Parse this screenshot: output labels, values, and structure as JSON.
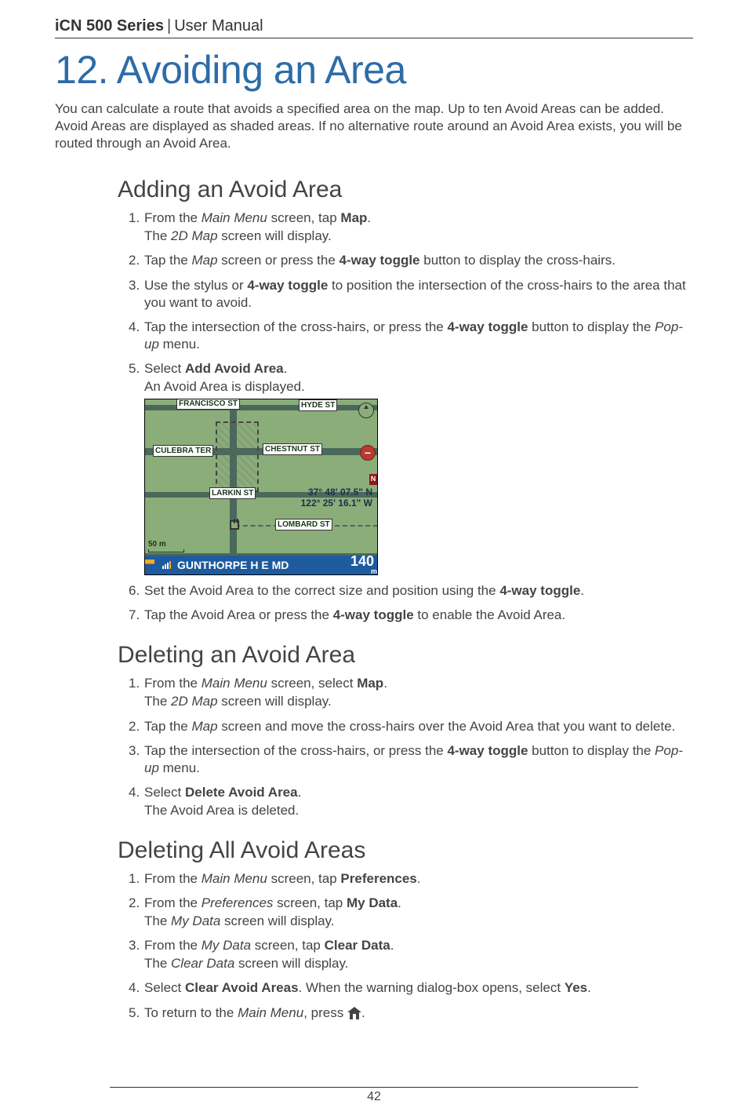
{
  "header": {
    "product": "iCN 500 Series",
    "separator": "|",
    "suffix": "User Manual"
  },
  "title": "12. Avoiding an Area",
  "intro": "You can calculate a route that avoids a specified area on the map. Up to ten Avoid Areas can be added. Avoid Areas are displayed as shaded areas. If no alternative route around an Avoid Area exists, you will be routed through an Avoid Area.",
  "sections": {
    "adding": {
      "heading": "Adding an Avoid Area",
      "steps": [
        {
          "num": "1.",
          "parts": [
            "From the ",
            {
              "i": "Main Menu"
            },
            " screen, tap ",
            {
              "b": "Map"
            },
            "."
          ],
          "sub": [
            "The ",
            {
              "i": "2D Map"
            },
            " screen will display."
          ]
        },
        {
          "num": "2.",
          "parts": [
            "Tap the ",
            {
              "i": "Map"
            },
            " screen or press the ",
            {
              "b": "4-way toggle"
            },
            " button to display the cross-hairs."
          ]
        },
        {
          "num": "3.",
          "parts": [
            "Use the stylus or ",
            {
              "b": "4-way toggle"
            },
            " to position the intersection of the cross-hairs to the area that you want to avoid."
          ]
        },
        {
          "num": "4.",
          "parts": [
            "Tap the intersection of the cross-hairs, or press the ",
            {
              "b": "4-way toggle"
            },
            " button to display the ",
            {
              "i": "Pop-up"
            },
            " menu."
          ]
        },
        {
          "num": "5.",
          "parts": [
            "Select ",
            {
              "b": "Add Avoid Area"
            },
            "."
          ],
          "sub": [
            "An Avoid Area is displayed."
          ]
        },
        {
          "num": "6.",
          "parts": [
            "Set the Avoid Area to the correct size and position using the ",
            {
              "b": "4-way toggle"
            },
            "."
          ]
        },
        {
          "num": "7.",
          "parts": [
            "Tap the Avoid Area or press the ",
            {
              "b": "4-way toggle"
            },
            " to enable the Avoid Area."
          ]
        }
      ]
    },
    "deleting": {
      "heading": "Deleting an Avoid Area",
      "steps": [
        {
          "num": "1.",
          "parts": [
            "From the ",
            {
              "i": "Main Menu"
            },
            " screen, select ",
            {
              "b": "Map"
            },
            "."
          ],
          "sub": [
            "The ",
            {
              "i": "2D Map"
            },
            " screen will display."
          ]
        },
        {
          "num": "2.",
          "parts": [
            "Tap the ",
            {
              "i": "Map"
            },
            " screen and move the cross-hairs over the Avoid Area that you want to delete."
          ]
        },
        {
          "num": "3.",
          "parts": [
            "Tap the intersection of the cross-hairs, or press the ",
            {
              "b": "4-way toggle"
            },
            " button to display the ",
            {
              "i": "Pop-up"
            },
            " menu."
          ]
        },
        {
          "num": "4.",
          "parts": [
            "Select ",
            {
              "b": "Delete Avoid Area"
            },
            "."
          ],
          "sub": [
            "The Avoid Area is deleted."
          ]
        }
      ]
    },
    "deletingAll": {
      "heading": "Deleting All Avoid Areas",
      "steps": [
        {
          "num": "1.",
          "parts": [
            "From the ",
            {
              "i": "Main Menu"
            },
            " screen, tap ",
            {
              "b": "Preferences"
            },
            "."
          ]
        },
        {
          "num": "2.",
          "parts": [
            "From the ",
            {
              "i": "Preferences"
            },
            " screen, tap ",
            {
              "b": "My Data"
            },
            "."
          ],
          "sub": [
            "The ",
            {
              "i": "My Data"
            },
            " screen will display."
          ]
        },
        {
          "num": "3.",
          "parts": [
            "From the ",
            {
              "i": "My Data"
            },
            " screen, tap ",
            {
              "b": "Clear Data"
            },
            "."
          ],
          "sub": [
            "The ",
            {
              "i": "Clear Data"
            },
            " screen will display."
          ]
        },
        {
          "num": "4.",
          "parts": [
            "Select ",
            {
              "b": "Clear Avoid Areas"
            },
            ". When the warning dialog-box opens, select ",
            {
              "b": "Yes"
            },
            "."
          ]
        },
        {
          "num": "5.",
          "parts": [
            "To return to the ",
            {
              "i": "Main Menu"
            },
            ", press "
          ],
          "homeIcon": true,
          "tail": "."
        }
      ]
    }
  },
  "map": {
    "streets": {
      "francisco": "FRANCISCO ST",
      "hyde": "HYDE ST",
      "culebra": "CULEBRA TER",
      "chestnut": "CHESTNUT ST",
      "larkin": "LARKIN ST",
      "lombard": "LOMBARD ST",
      "bottom_road": "GUNTHORPE H E MD"
    },
    "coords1": "37° 48' 07.5\" N",
    "coords2": "122° 25' 16.1\" W",
    "n_tag": "N",
    "plus": "+",
    "minus": "−",
    "scale": "50 m",
    "distance_value": "140",
    "distance_unit": "m"
  },
  "page_number": "42"
}
